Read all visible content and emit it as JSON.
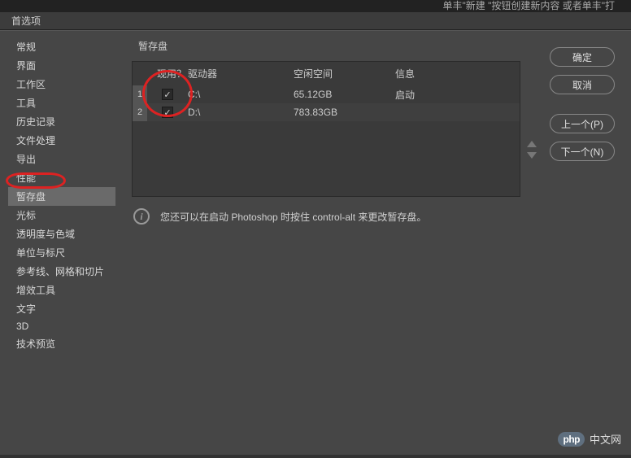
{
  "top_hint": "单丰\"新建 \"按钮创建新内容 或者单丰\"打",
  "window_title": "首选项",
  "sidebar": {
    "items": [
      {
        "label": "常规"
      },
      {
        "label": "界面"
      },
      {
        "label": "工作区"
      },
      {
        "label": "工具"
      },
      {
        "label": "历史记录"
      },
      {
        "label": "文件处理"
      },
      {
        "label": "导出"
      },
      {
        "label": "性能"
      },
      {
        "label": "暂存盘"
      },
      {
        "label": "光标"
      },
      {
        "label": "透明度与色域"
      },
      {
        "label": "单位与标尺"
      },
      {
        "label": "参考线、网格和切片"
      },
      {
        "label": "增效工具"
      },
      {
        "label": "文字"
      },
      {
        "label": "3D"
      },
      {
        "label": "技术预览"
      }
    ],
    "selected_index": 8
  },
  "content": {
    "title": "暂存盘",
    "columns": {
      "active": "现用？",
      "drive": "驱动器",
      "free": "空闲空间",
      "info": "信息"
    },
    "rows": [
      {
        "num": "1",
        "checked": true,
        "drive": "C:\\",
        "free": "65.12GB",
        "info": "启动"
      },
      {
        "num": "2",
        "checked": true,
        "drive": "D:\\",
        "free": "783.83GB",
        "info": ""
      }
    ],
    "hint": "您还可以在启动 Photoshop 时按住 control-alt 来更改暂存盘。"
  },
  "buttons": {
    "ok": "确定",
    "cancel": "取消",
    "prev": "上一个(P)",
    "next": "下一个(N)"
  },
  "watermark": {
    "badge": "php",
    "text": "中文网"
  }
}
